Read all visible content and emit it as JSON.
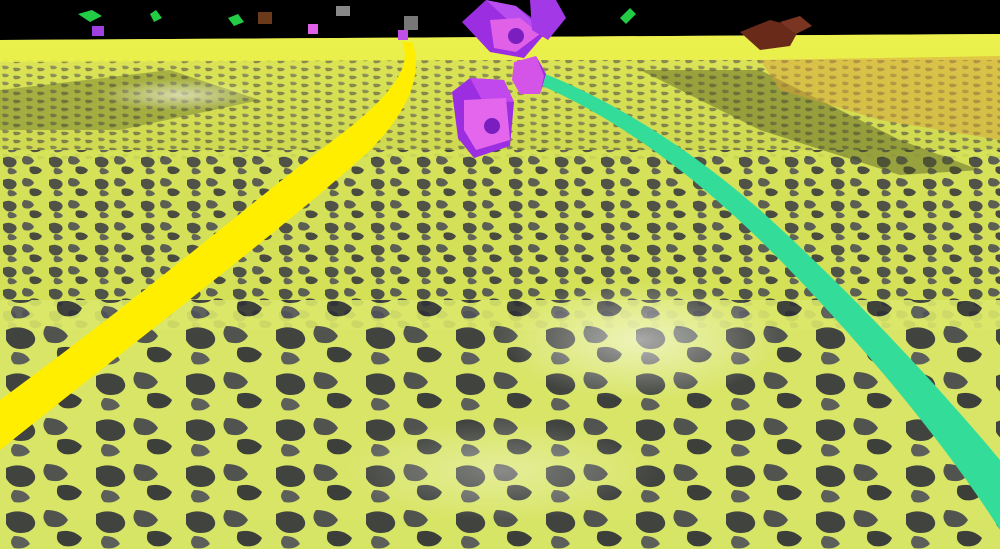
{
  "scene": {
    "sky_color": "#000000",
    "terrain": {
      "base_color": "#d8e65a",
      "highlight_color": "#f0ff7a",
      "crack_color": "#3a3a44",
      "far_glow_color": "#e8ec3a",
      "shadow_color": "#6f7a2a"
    },
    "paths": [
      {
        "name": "yellow-path",
        "color": "#ffee00"
      },
      {
        "name": "green-path",
        "color": "#33dd99"
      }
    ],
    "objects": [
      {
        "name": "purple-cube-cluster",
        "color": "#9a2ee0",
        "face_color": "#e060e8"
      },
      {
        "name": "distant-green-craft",
        "color": "#22cc44"
      },
      {
        "name": "distant-brown-structure",
        "color": "#6a2a1a"
      },
      {
        "name": "distant-gray-drone",
        "color": "#888888"
      }
    ]
  }
}
